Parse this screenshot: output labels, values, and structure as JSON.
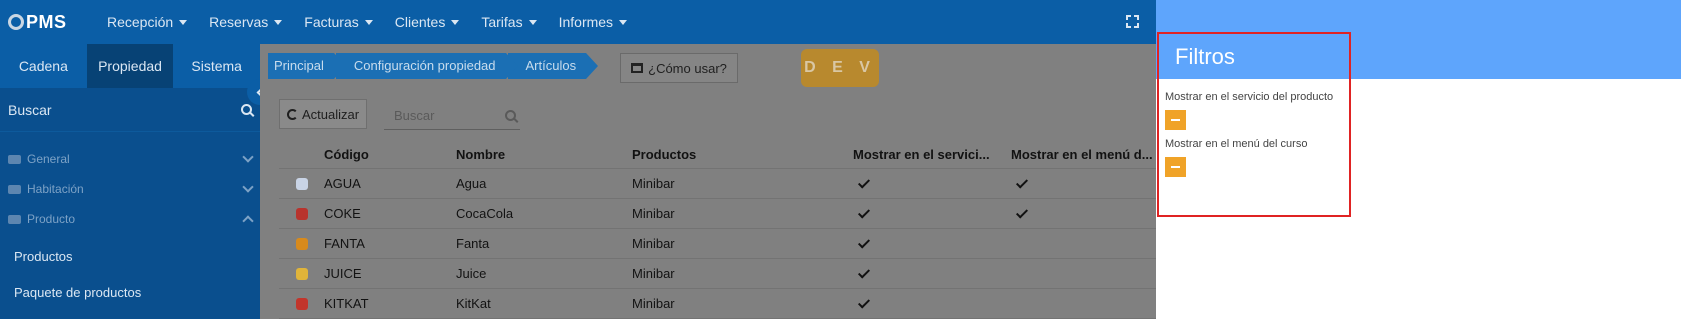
{
  "app": {
    "logo": "PMS",
    "menu": [
      "Recepción",
      "Reservas",
      "Facturas",
      "Clientes",
      "Tarifas",
      "Informes"
    ]
  },
  "sidebar": {
    "tabs": [
      "Cadena",
      "Propiedad",
      "Sistema"
    ],
    "active_tab": "Propiedad",
    "search_placeholder": "Buscar",
    "groups": [
      {
        "label": "General",
        "expanded": false
      },
      {
        "label": "Habitación",
        "expanded": false
      },
      {
        "label": "Producto",
        "expanded": true
      }
    ],
    "links": [
      "Productos",
      "Paquete de productos"
    ]
  },
  "main": {
    "breadcrumb": [
      "Principal",
      "Configuración propiedad",
      "Artículos"
    ],
    "how_to": "¿Cómo usar?",
    "env_badge": "D E V",
    "refresh": "Actualizar",
    "search_placeholder": "Buscar",
    "columns": [
      "Código",
      "Nombre",
      "Productos",
      "Mostrar en el servici...",
      "Mostrar en el menú d..."
    ],
    "rows": [
      {
        "code": "AGUA",
        "name": "Agua",
        "product": "Minibar",
        "service": true,
        "menu": true,
        "thumb": "#c9d4e6"
      },
      {
        "code": "COKE",
        "name": "CocaCola",
        "product": "Minibar",
        "service": true,
        "menu": true,
        "thumb": "#b8332d"
      },
      {
        "code": "FANTA",
        "name": "Fanta",
        "product": "Minibar",
        "service": true,
        "menu": false,
        "thumb": "#d88a1c"
      },
      {
        "code": "JUICE",
        "name": "Juice",
        "product": "Minibar",
        "service": true,
        "menu": false,
        "thumb": "#e0b43a"
      },
      {
        "code": "KITKAT",
        "name": "KitKat",
        "product": "Minibar",
        "service": true,
        "menu": false,
        "thumb": "#c2352b"
      }
    ]
  },
  "filters": {
    "title": "Filtros",
    "items": [
      {
        "label": "Mostrar en el servicio del producto",
        "state": "indeterminate"
      },
      {
        "label": "Mostrar en el menú del curso",
        "state": "indeterminate"
      }
    ]
  },
  "colors": {
    "topbar": "#0b5ea6",
    "panel_header": "#5ea5fc",
    "toggle": "#f0a328",
    "highlight": "#e02323"
  }
}
